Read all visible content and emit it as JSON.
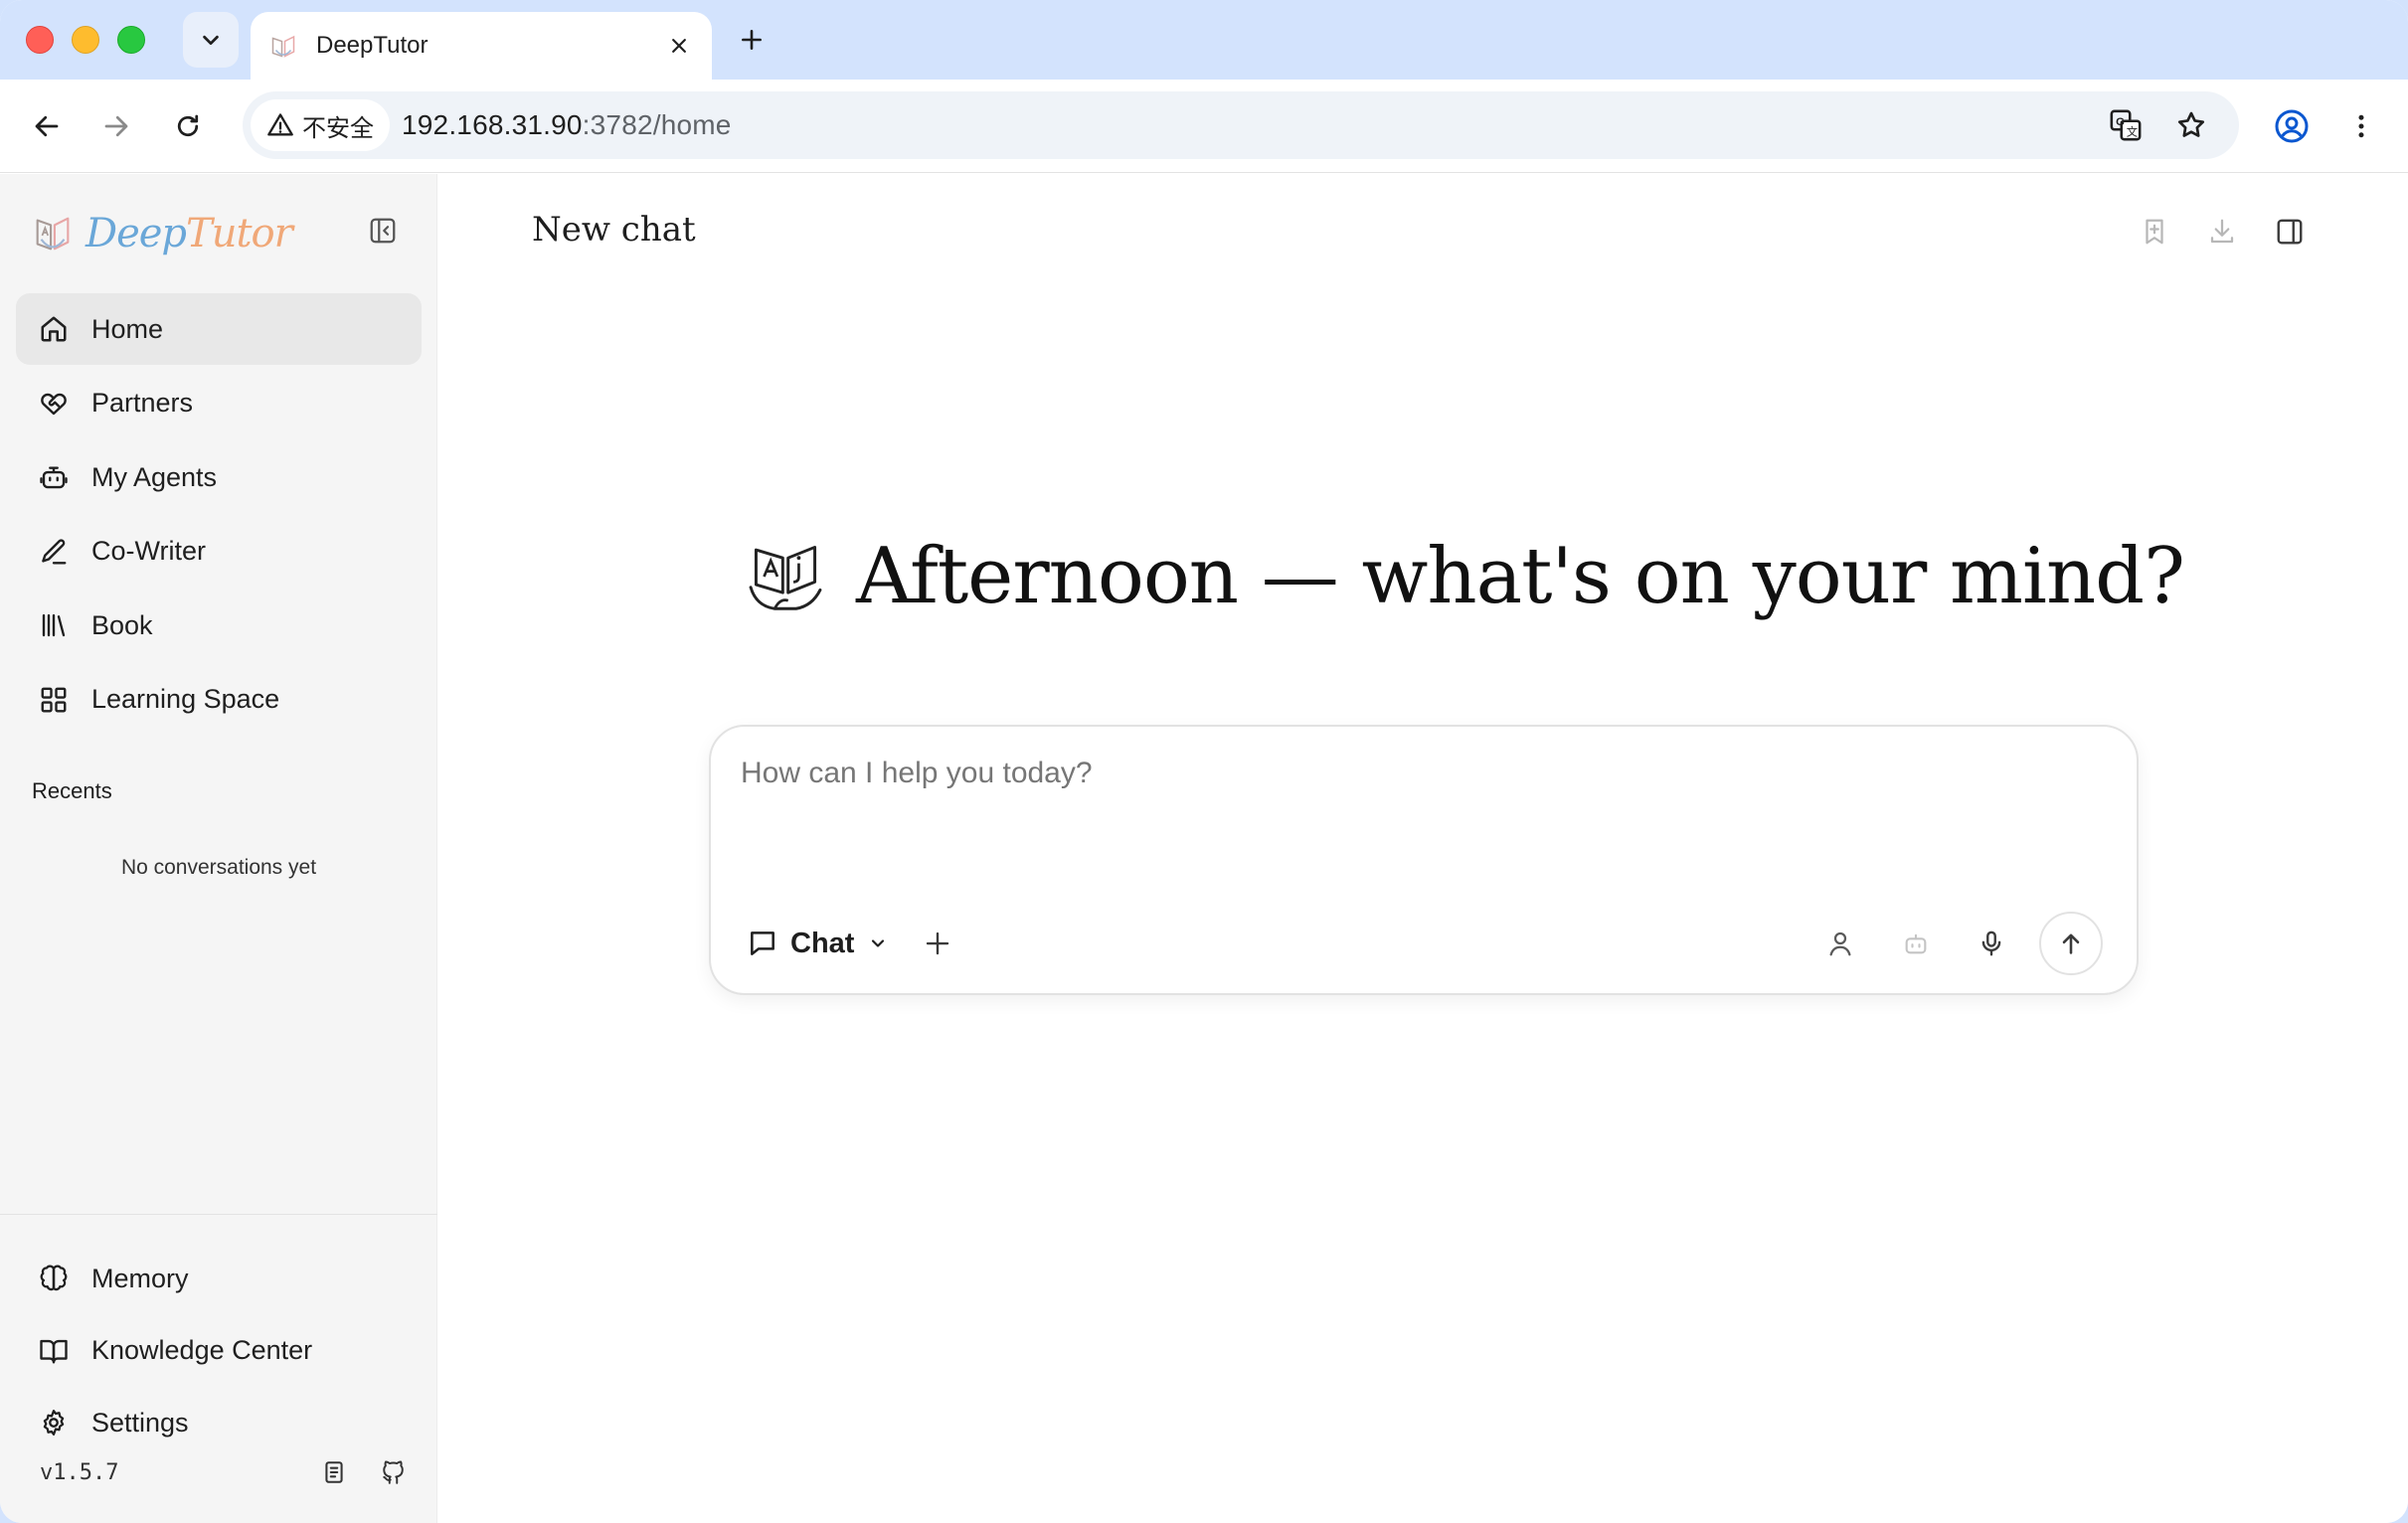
{
  "browser": {
    "tab_title": "DeepTutor",
    "security_label": "不安全",
    "url_host": "192.168.31.90",
    "url_path": ":3782/home"
  },
  "sidebar": {
    "brand_part1": "Deep",
    "brand_part2": "Tutor",
    "items": [
      {
        "label": "Home",
        "icon": "home-icon",
        "active": true
      },
      {
        "label": "Partners",
        "icon": "handshake-heart-icon"
      },
      {
        "label": "My Agents",
        "icon": "robot-icon"
      },
      {
        "label": "Co-Writer",
        "icon": "pen-icon"
      },
      {
        "label": "Book",
        "icon": "library-icon"
      },
      {
        "label": "Learning Space",
        "icon": "grid-icon"
      }
    ],
    "recents_heading": "Recents",
    "recents_empty": "No conversations yet",
    "bottom_items": [
      {
        "label": "Memory",
        "icon": "brain-icon"
      },
      {
        "label": "Knowledge Center",
        "icon": "book-open-icon"
      },
      {
        "label": "Settings",
        "icon": "gear-icon"
      }
    ],
    "version": "v1.5.7"
  },
  "main": {
    "chat_title": "New chat",
    "greeting": "Afternoon — what's on your mind?",
    "composer": {
      "placeholder": "How can I help you today?",
      "mode_label": "Chat"
    }
  },
  "colors": {
    "tabstrip": "#d3e3fd",
    "sidebar_bg": "#f5f5f5",
    "active_item": "#e8e8e8",
    "brand_blue": "#6aa7d8",
    "brand_orange": "#f0a878"
  }
}
